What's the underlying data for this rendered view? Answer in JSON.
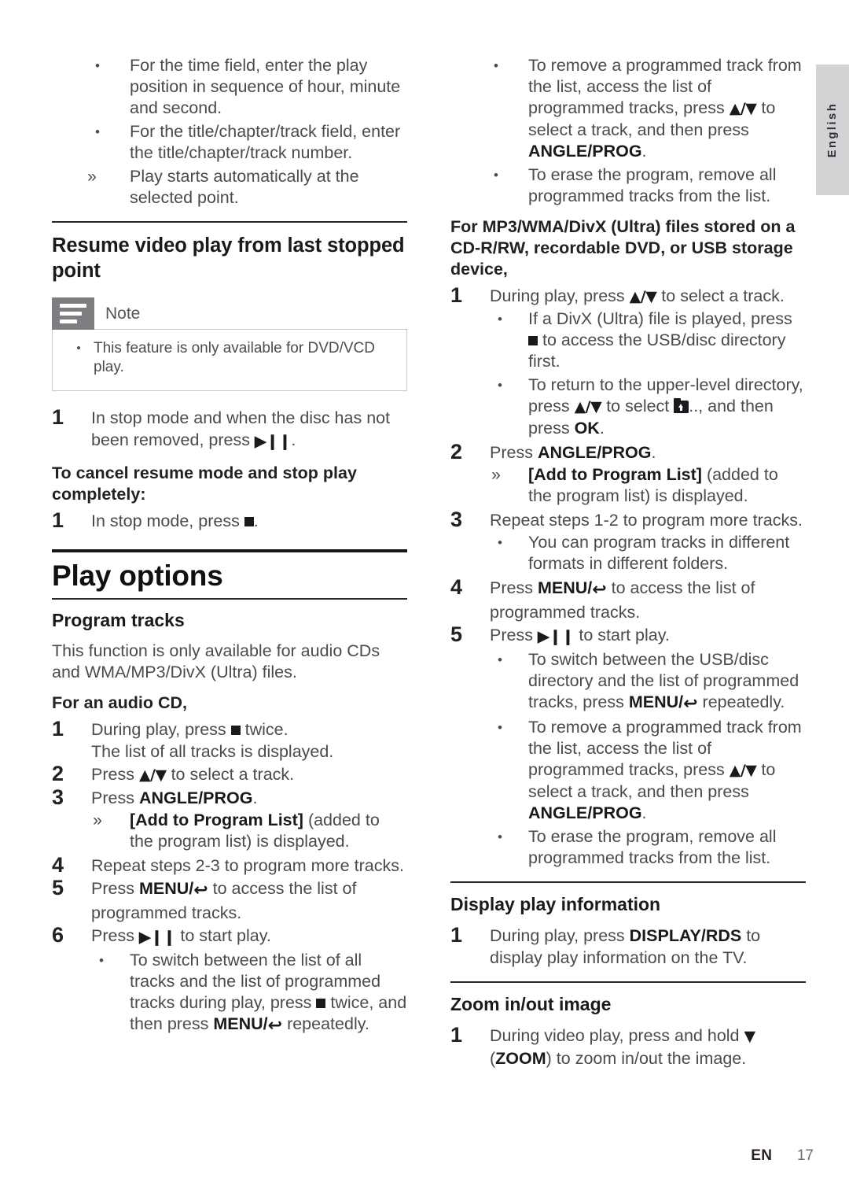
{
  "page": {
    "language_tab": "English",
    "footer": {
      "lang_code": "EN",
      "page_number": "17"
    }
  },
  "left_column": {
    "intro_bullets": [
      {
        "mark": "•",
        "text": "For the time field, enter the play position in sequence of hour, minute and second."
      },
      {
        "mark": "•",
        "text": "For the title/chapter/track field, enter the title/chapter/track number."
      },
      {
        "mark": "»",
        "text": "Play starts automatically at the selected point."
      }
    ],
    "resume_section": {
      "heading": "Resume video play from last stopped point",
      "note": {
        "title": "Note",
        "bullets": [
          "This feature is only available for DVD/VCD play."
        ]
      },
      "step1_number": "1",
      "step1_prefix": "In stop mode and when the disc has not been removed, press ",
      "step1_suffix": ".",
      "cancel_heading": "To cancel resume mode and stop play completely:",
      "cancel_step_number": "1",
      "cancel_step_prefix": "In stop mode, press ",
      "cancel_step_suffix": "."
    },
    "play_options": {
      "chapter_title": "Play options",
      "section_title": "Program tracks",
      "intro": "This function is only available for audio CDs and WMA/MP3/DivX (Ultra) files.",
      "audio_cd_heading": "For an audio CD,",
      "steps": [
        {
          "num": "1",
          "prefix": "During play, press ",
          "suffix": " twice.",
          "extra": "The list of all tracks is displayed."
        },
        {
          "num": "2",
          "prefix": "Press ",
          "arrows": "▲/▼",
          "suffix": " to select a track."
        },
        {
          "num": "3",
          "prefix": "Press ",
          "key": "ANGLE/PROG",
          "suffix": "."
        },
        {
          "num": "4",
          "text": "Repeat steps 2-3 to program more tracks."
        },
        {
          "num": "5",
          "prefix": "Press ",
          "key": "MENU/",
          "suffix": " to access the list of programmed tracks."
        },
        {
          "num": "6",
          "prefix": "Press ",
          "suffix": " to start play."
        }
      ],
      "step3_sub": {
        "mark": "»",
        "bold": "[Add to Program List]",
        "rest": " (added to the program list) is displayed."
      },
      "step6_sub": {
        "mark": "•",
        "part1": "To switch between the list of all tracks and the list of programmed tracks during play, press ",
        "part2": " twice, and then press ",
        "key": "MENU/",
        "part3": " repeatedly."
      }
    }
  },
  "right_column": {
    "top_bullets": [
      {
        "mark": "•",
        "part1": "To remove a programmed track from the list, access the list of programmed tracks, press ",
        "arrows": "▲/▼",
        "part2": " to select a track, and then press ",
        "key": "ANGLE/PROG",
        "part3": "."
      },
      {
        "mark": "•",
        "text": "To erase the program, remove all programmed tracks from the list."
      }
    ],
    "mp3_heading": "For MP3/WMA/DivX (Ultra) files stored on a CD-R/RW, recordable DVD, or USB storage device,",
    "steps": [
      {
        "num": "1",
        "prefix": "During play, press ",
        "arrows": "▲/▼",
        "suffix": " to select a track."
      },
      {
        "num": "2",
        "prefix": "Press ",
        "key": "ANGLE/PROG",
        "suffix": "."
      },
      {
        "num": "3",
        "text": "Repeat steps 1-2 to program more tracks."
      },
      {
        "num": "4",
        "prefix": "Press ",
        "key": "MENU/",
        "suffix": " to access the list of programmed tracks."
      },
      {
        "num": "5",
        "prefix": "Press ",
        "suffix": " to start play."
      }
    ],
    "step1_subs": [
      {
        "mark": "•",
        "part1": "If a DivX (Ultra) file is played, press ",
        "part2": " to access the USB/disc directory first."
      },
      {
        "mark": "•",
        "part1": "To return to the upper-level directory, press ",
        "arrows": "▲/▼",
        "part2": " to select ",
        "folder_label": "..,",
        "part3": " and then press ",
        "key": "OK",
        "part4": "."
      }
    ],
    "step2_sub": {
      "mark": "»",
      "bold": "[Add to Program List]",
      "rest": " (added to the program list) is displayed."
    },
    "step3_sub": {
      "mark": "•",
      "text": "You can program tracks in different formats in different folders."
    },
    "step5_sub": {
      "mark": "•",
      "part1": "To switch between the USB/disc directory and the list of programmed tracks, press ",
      "key": "MENU/",
      "part2": " repeatedly."
    },
    "bottom_bullets": [
      {
        "mark": "•",
        "part1": "To remove a programmed track from the list, access the list of programmed tracks, press ",
        "arrows": "▲/▼",
        "part2": " to select a track, and then press ",
        "key": "ANGLE/PROG",
        "part3": "."
      },
      {
        "mark": "•",
        "text": "To erase the program, remove all programmed tracks from the list."
      }
    ],
    "display_section": {
      "title": "Display play information",
      "step_num": "1",
      "prefix": "During play, press ",
      "key": "DISPLAY/RDS",
      "suffix": " to display play information on the TV."
    },
    "zoom_section": {
      "title": "Zoom in/out image",
      "step_num": "1",
      "prefix": "During video play, press and hold ",
      "arrow": "▼",
      "mid": " (",
      "key": "ZOOM",
      "suffix": ") to zoom in/out the image."
    }
  }
}
